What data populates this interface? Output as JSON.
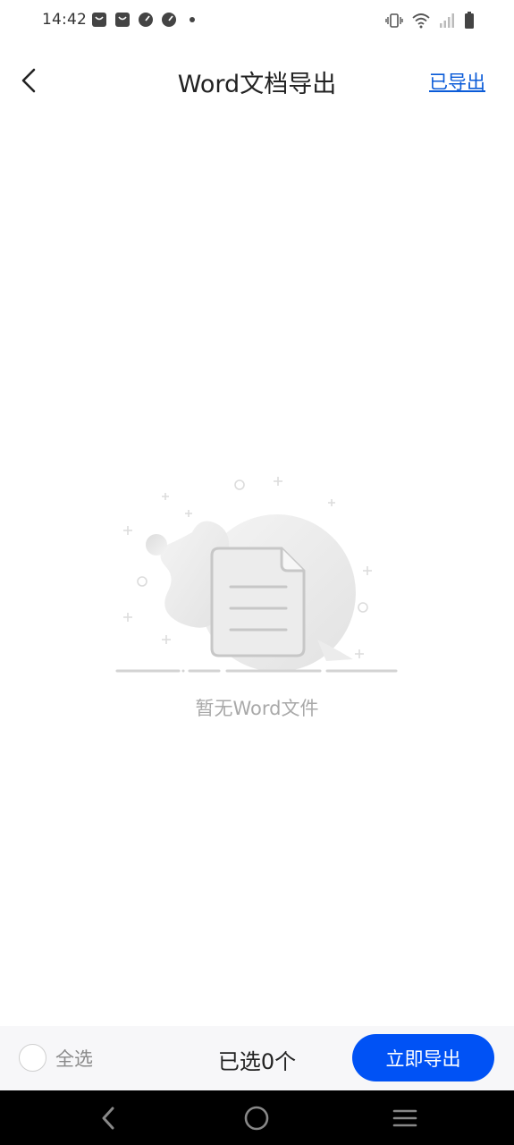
{
  "status_bar": {
    "time": "14:42",
    "notification_icons": [
      "bag-icon",
      "bag-icon",
      "speedometer-icon",
      "speedometer-icon",
      "dot-icon"
    ],
    "system_icons": [
      "vibrate-icon",
      "wifi-icon",
      "signal-icon",
      "battery-icon"
    ]
  },
  "header": {
    "title": "Word文档导出",
    "exported_link": "已导出",
    "back_icon": "chevron-left-icon"
  },
  "empty_state": {
    "message": "暂无Word文件",
    "illustration_icon": "document-icon"
  },
  "action_bar": {
    "select_all_label": "全选",
    "selected_count": "已选0个",
    "export_button": "立即导出"
  },
  "nav_bar": {
    "icons": [
      "back-triangle-icon",
      "home-circle-icon",
      "menu-lines-icon"
    ]
  },
  "colors": {
    "accent": "#0052f5",
    "link": "#0a5bd8",
    "empty_text": "#a9a9a9",
    "action_bar_bg": "#f7f7f9"
  }
}
